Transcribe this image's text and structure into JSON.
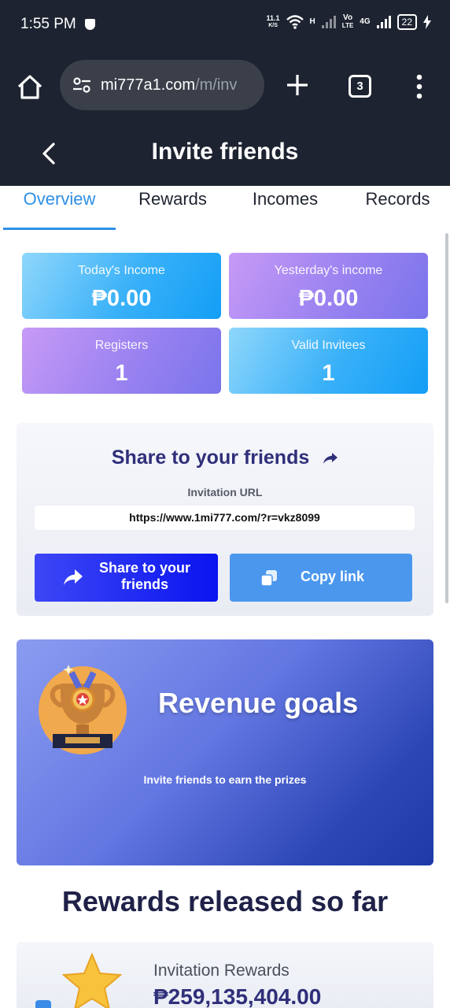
{
  "status_bar": {
    "time": "1:55 PM",
    "net_speed": "11.1",
    "net_unit": "K/S",
    "net_h": "H",
    "volte_top": "Vo",
    "volte_bottom": "LTE",
    "net_4g": "4G",
    "battery": "22"
  },
  "browser": {
    "url_domain": "mi777a1.com",
    "url_path": "/m/inv",
    "tab_count": "3"
  },
  "header": {
    "title": "Invite friends"
  },
  "tabs": [
    {
      "label": "Overview",
      "active": true
    },
    {
      "label": "Rewards",
      "active": false
    },
    {
      "label": "Incomes",
      "active": false
    },
    {
      "label": "Records",
      "active": false
    }
  ],
  "stats": {
    "today_income": {
      "label": "Today's Income",
      "value": "₱0.00"
    },
    "yesterday_income": {
      "label": "Yesterday's income",
      "value": "₱0.00"
    },
    "registers": {
      "label": "Registers",
      "value": "1"
    },
    "valid_invitees": {
      "label": "Valid Invitees",
      "value": "1"
    }
  },
  "share": {
    "title": "Share to your friends",
    "url_label": "Invitation URL",
    "url": "https://www.1mi777.com/?r=vkz8099",
    "share_button": "Share to your friends",
    "copy_button": "Copy link"
  },
  "revenue": {
    "title": "Revenue goals",
    "subtitle": "Invite friends to earn the prizes"
  },
  "released": {
    "title": "Rewards released so far",
    "invitation_label": "Invitation Rewards",
    "invitation_value": "₱259,135,404.00"
  },
  "colors": {
    "dark_bar": "#1d2330",
    "accent": "#2d8fe6",
    "share_blue": "#0a14f0",
    "copy_blue": "#4b97ee",
    "heading_navy": "#2f2f7a"
  }
}
